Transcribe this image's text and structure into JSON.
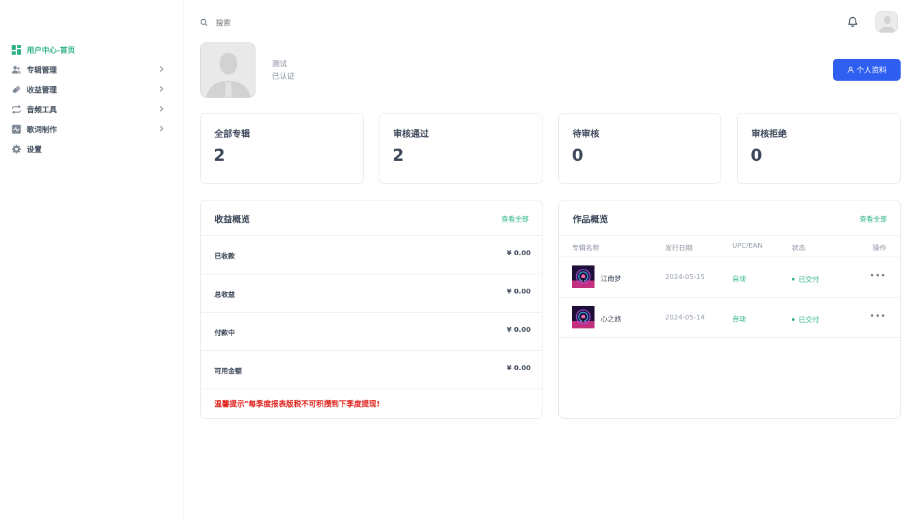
{
  "sidebar": {
    "items": [
      {
        "label": "用户中心-首页",
        "icon": "dashboard-icon",
        "active": true
      },
      {
        "label": "专辑管理",
        "icon": "users-icon"
      },
      {
        "label": "收益管理",
        "icon": "pill-icon"
      },
      {
        "label": "音频工具",
        "icon": "repeat-icon"
      },
      {
        "label": "歌词制作",
        "icon": "activity-icon"
      },
      {
        "label": "设置",
        "icon": "gear-icon"
      }
    ]
  },
  "search": {
    "placeholder": "搜索"
  },
  "profile": {
    "name": "测试",
    "status": "已认证",
    "button_label": "个人资料"
  },
  "stats": [
    {
      "title": "全部专辑",
      "value": "2"
    },
    {
      "title": "审核通过",
      "value": "2"
    },
    {
      "title": "待审核",
      "value": "0"
    },
    {
      "title": "审核拒绝",
      "value": "0"
    }
  ],
  "income": {
    "title": "收益概览",
    "more": "查看全部",
    "rows": [
      {
        "label": "已收款",
        "value": "¥ 0.00"
      },
      {
        "label": "总收益",
        "value": "¥ 0.00"
      },
      {
        "label": "付款中",
        "value": "¥ 0.00"
      },
      {
        "label": "可用金额",
        "value": "¥ 0.00"
      }
    ],
    "tip": "温馨提示\"每季度报表版税不可积攒到下季度提现!"
  },
  "works": {
    "title": "作品概览",
    "more": "查看全部",
    "columns": [
      "专辑名称",
      "发行日期",
      "UPC/EAN",
      "状态",
      "操作"
    ],
    "rows": [
      {
        "name": "江南梦",
        "date": "2024-05-15",
        "upc": "自动",
        "status": "已交付",
        "ops": "•••"
      },
      {
        "name": "心之旅",
        "date": "2024-05-14",
        "upc": "自动",
        "status": "已交付",
        "ops": "•••"
      }
    ]
  },
  "colors": {
    "accent": "#2fb384",
    "primary": "#2f5ff0",
    "warning": "#e0231e"
  }
}
